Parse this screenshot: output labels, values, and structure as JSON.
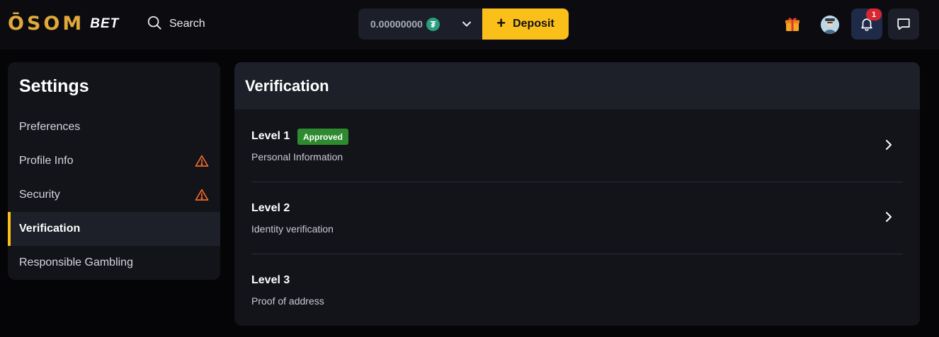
{
  "header": {
    "logo_mark": "ŌSOM",
    "logo_bet": "BET",
    "search_label": "Search",
    "wallet_balance": "0.00000000",
    "currency_symbol": "₮",
    "deposit_label": "Deposit",
    "notification_count": "1",
    "colors": {
      "accent": "#fbbf1a",
      "badge": "#d9262f",
      "tether": "#2a9d7c"
    }
  },
  "sidebar": {
    "title": "Settings",
    "items": [
      {
        "label": "Preferences",
        "warning": false,
        "active": false
      },
      {
        "label": "Profile Info",
        "warning": true,
        "active": false
      },
      {
        "label": "Security",
        "warning": true,
        "active": false
      },
      {
        "label": "Verification",
        "warning": false,
        "active": true
      },
      {
        "label": "Responsible Gambling",
        "warning": false,
        "active": false
      }
    ]
  },
  "main": {
    "title": "Verification",
    "levels": [
      {
        "title": "Level 1",
        "subtitle": "Personal Information",
        "status": "Approved"
      },
      {
        "title": "Level 2",
        "subtitle": "Identity verification"
      },
      {
        "title": "Level 3",
        "subtitle": "Proof of address"
      }
    ]
  }
}
